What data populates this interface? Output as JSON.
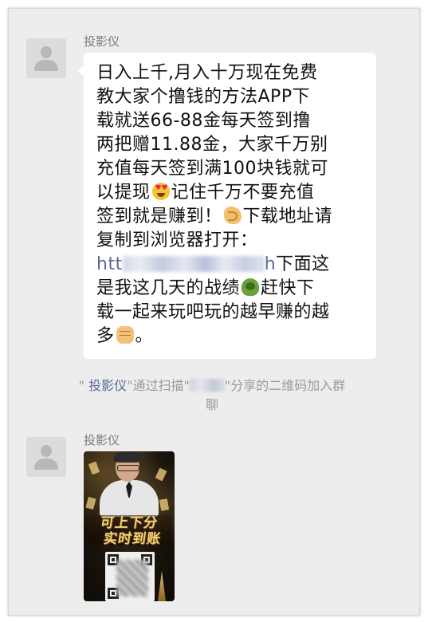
{
  "messages": [
    {
      "sender": "投影仪",
      "text": {
        "line1": "日入上千,月入十万现在免费",
        "line2": "教大家个撸钱的方法APP下",
        "line3": "载就送66-88金每天签到撸",
        "line4": "两把赠11.88金，大家千万别",
        "line5": "充值每天签到满100块钱就可",
        "line6a": "以提现",
        "line6b": "记住千万不要充值",
        "line7a": "签到就是赚到！",
        "line7b": "下载地址请",
        "line8": "复制到浏览器打开：",
        "line9_link_start": "htt",
        "line9_link_end": "h",
        "line9_rest": "下面这",
        "line10a": "是我这几天的战绩",
        "line10b": "赶快下",
        "line11": "载一起来玩吧玩的越早赚的越",
        "line12a": "多",
        "line12b": "。"
      },
      "emojis": [
        "heart-eyes-emoji",
        "pointing-hand-emoji",
        "turtle-emoji",
        "fist-emoji"
      ]
    },
    {
      "sender": "投影仪",
      "image": {
        "banner_line1": "可上下分",
        "banner_line2": "实时到账"
      }
    }
  ],
  "system_message": {
    "quote_open": "\"",
    "name": "投影仪",
    "middle": "\"通过扫描\"",
    "after": "\"分享的二维码加入群",
    "wrap": "聊"
  },
  "colors": {
    "background": "#ededed",
    "bubble": "#ffffff",
    "link": "#576b95",
    "system_text": "#9b9b9b",
    "sender_name": "#7a7a7a"
  }
}
